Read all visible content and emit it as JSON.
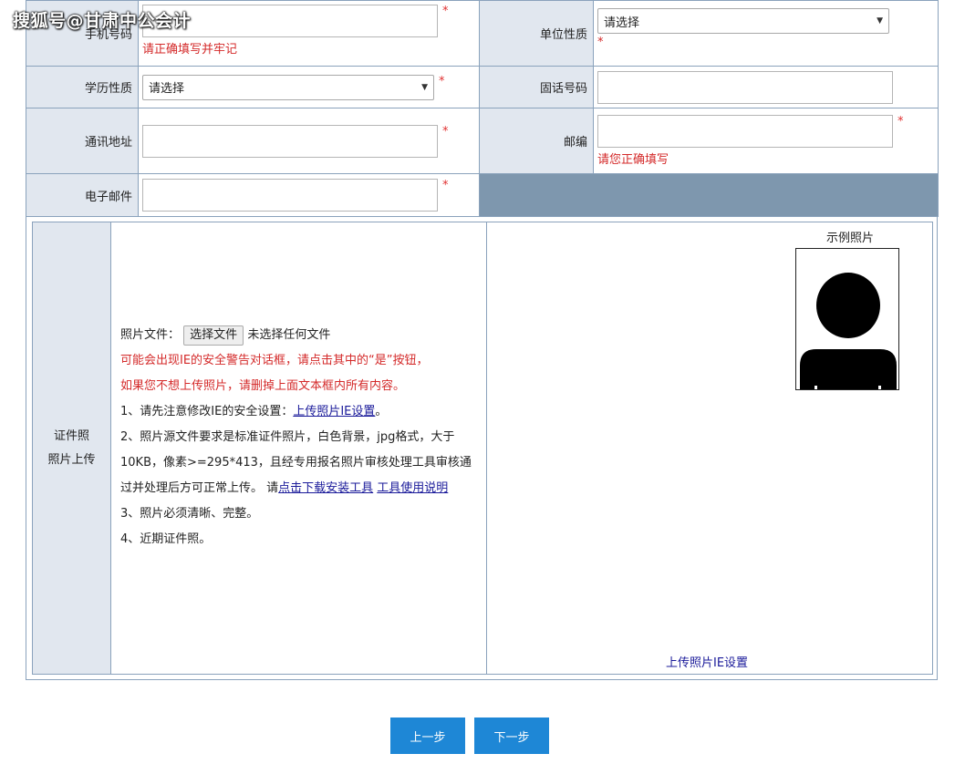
{
  "watermark": "搜狐号@甘肃中公会计",
  "rows": {
    "phone": {
      "label": "手机号码",
      "required": "*",
      "error": "请正确填写并牢记"
    },
    "unit_type": {
      "label": "单位性质",
      "select_value": "请选择",
      "required": "*"
    },
    "education": {
      "label": "学历性质",
      "select_value": "请选择",
      "required": "*"
    },
    "landline": {
      "label": "固话号码"
    },
    "address": {
      "label": "通讯地址",
      "required": "*"
    },
    "postcode": {
      "label": "邮编",
      "required": "*",
      "error": "请您正确填写"
    },
    "email": {
      "label": "电子邮件",
      "required": "*"
    }
  },
  "photo_section": {
    "label_line1": "证件照",
    "label_line2": "照片上传",
    "file_label": "照片文件：",
    "file_button": "选择文件",
    "file_status": "未选择任何文件",
    "warning_line1": "可能会出现IE的安全警告对话框，请点击其中的“是”按钮，",
    "warning_line2": "如果您不想上传照片，请删掉上面文本框内所有内容。",
    "note1_prefix": "1、请先注意修改IE的安全设置：",
    "note1_link": "上传照片IE设置",
    "note1_suffix": "。",
    "note2_text": "2、照片源文件要求是标准证件照片，白色背景，jpg格式，大于10KB，像素>=295*413，且经专用报名照片审核处理工具审核通过并处理后方可正常上传。 请",
    "note2_link1": "点击下载安装工具",
    "note2_link2": "工具使用说明",
    "note3": "3、照片必须清晰、完整。",
    "note4": "4、近期证件照。",
    "sample_title": "示例照片",
    "bottom_link": "上传照片IE设置"
  },
  "buttons": {
    "prev": "上一步",
    "next": "下一步"
  },
  "colors": {
    "label_bg": "#e1e7ef",
    "border": "#8aa2bc",
    "gray_cell": "#7e97ae",
    "error": "#d42a2a",
    "button_bg": "#1e87d6",
    "link": "#1a1a9a"
  }
}
